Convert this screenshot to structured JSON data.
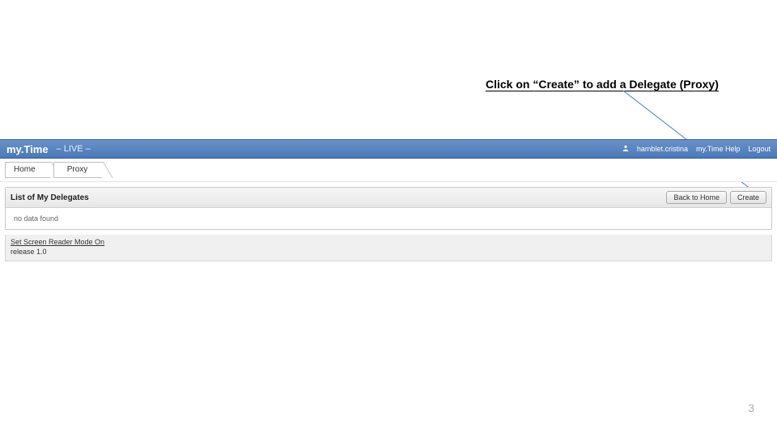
{
  "annotation": "Click on “Create” to add a Delegate (Proxy)",
  "topbar": {
    "brand": "my.Time",
    "env": "– LIVE –",
    "user": "hamblet.cristina",
    "help": "my.Time Help",
    "logout": "Logout"
  },
  "breadcrumb": [
    {
      "label": "Home"
    },
    {
      "label": "Proxy"
    }
  ],
  "panel": {
    "title": "List of My Delegates",
    "back_btn": "Back to Home",
    "create_btn": "Create",
    "empty": "no data found"
  },
  "footer": {
    "screen_reader": "Set Screen Reader Mode On",
    "release": "release 1.0"
  },
  "page_number": "3"
}
